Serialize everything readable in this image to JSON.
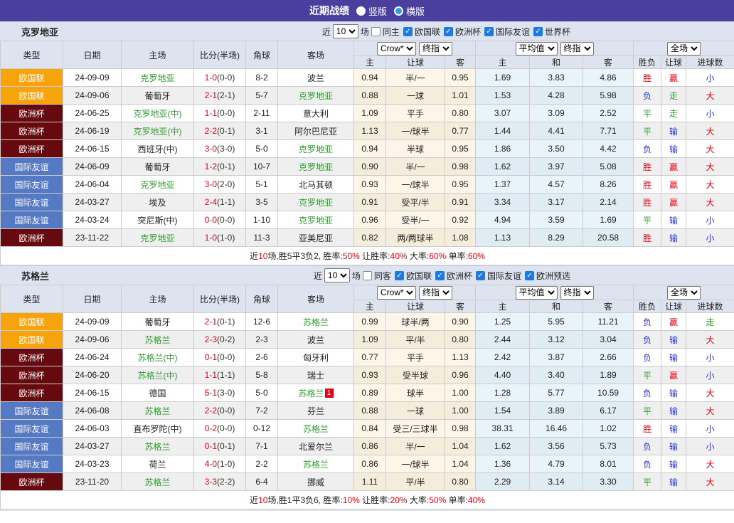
{
  "titlebar": {
    "title": "近期战绩",
    "radios": [
      {
        "label": "竖版",
        "selected": true
      },
      {
        "label": "横版",
        "selected": false
      }
    ]
  },
  "filter_labels": {
    "near": "近",
    "count": "10",
    "games": "场"
  },
  "table_head": {
    "cols": [
      "类型",
      "日期",
      "主场",
      "比分(半场)",
      "角球",
      "客场"
    ],
    "sub": [
      "主",
      "让球",
      "客",
      "主",
      "和",
      "客",
      "胜负",
      "让球",
      "进球数"
    ],
    "dropdowns": {
      "crow": "Crow*",
      "final1": "终指",
      "avg": "平均值",
      "final2": "终指",
      "full": "全场"
    }
  },
  "type_styles": {
    "欧国联": "#f7a30c",
    "欧洲杯": "#660a10",
    "国际友谊": "#5679c3"
  },
  "result_colors": {
    "red": "#e60012",
    "green": "#2f9e2f",
    "blue": "#2b35c9"
  },
  "sections": [
    {
      "team": "克罗地亚",
      "same_side_label": "同主",
      "leagues": [
        "欧国联",
        "欧洲杯",
        "国际友谊",
        "世界杯"
      ],
      "rows": [
        {
          "type": "欧国联",
          "date": "24-09-09",
          "home": "克罗地亚",
          "hg": true,
          "score": "1-0",
          "half": "(0-0)",
          "corner": "8-2",
          "away": "波兰",
          "ag": false,
          "odds": [
            "0.94",
            "半/一",
            "0.95"
          ],
          "avg": [
            "1.69",
            "3.83",
            "4.86"
          ],
          "res": [
            [
              "胜",
              "red"
            ],
            [
              "赢",
              "red"
            ],
            [
              "小",
              "blue"
            ]
          ]
        },
        {
          "type": "欧国联",
          "date": "24-09-06",
          "home": "葡萄牙",
          "hg": false,
          "score": "2-1",
          "half": "(2-1)",
          "corner": "5-7",
          "away": "克罗地亚",
          "ag": true,
          "odds": [
            "0.88",
            "一球",
            "1.01"
          ],
          "avg": [
            "1.53",
            "4.28",
            "5.98"
          ],
          "res": [
            [
              "负",
              "blue"
            ],
            [
              "走",
              "green"
            ],
            [
              "大",
              "red"
            ]
          ]
        },
        {
          "type": "欧洲杯",
          "date": "24-06-25",
          "home": "克罗地亚(中)",
          "hg": true,
          "score": "1-1",
          "half": "(0-0)",
          "corner": "2-11",
          "away": "意大利",
          "ag": false,
          "odds": [
            "1.09",
            "平手",
            "0.80"
          ],
          "avg": [
            "3.07",
            "3.09",
            "2.52"
          ],
          "res": [
            [
              "平",
              "green"
            ],
            [
              "走",
              "green"
            ],
            [
              "小",
              "blue"
            ]
          ]
        },
        {
          "type": "欧洲杯",
          "date": "24-06-19",
          "home": "克罗地亚(中)",
          "hg": true,
          "score": "2-2",
          "half": "(0-1)",
          "corner": "3-1",
          "away": "阿尔巴尼亚",
          "ag": false,
          "odds": [
            "1.13",
            "一/球半",
            "0.77"
          ],
          "avg": [
            "1.44",
            "4.41",
            "7.71"
          ],
          "res": [
            [
              "平",
              "green"
            ],
            [
              "输",
              "blue"
            ],
            [
              "大",
              "red"
            ]
          ]
        },
        {
          "type": "欧洲杯",
          "date": "24-06-15",
          "home": "西班牙(中)",
          "hg": false,
          "score": "3-0",
          "half": "(3-0)",
          "corner": "5-0",
          "away": "克罗地亚",
          "ag": true,
          "odds": [
            "0.94",
            "半球",
            "0.95"
          ],
          "avg": [
            "1.86",
            "3.50",
            "4.42"
          ],
          "res": [
            [
              "负",
              "blue"
            ],
            [
              "输",
              "blue"
            ],
            [
              "大",
              "red"
            ]
          ]
        },
        {
          "type": "国际友谊",
          "date": "24-06-09",
          "home": "葡萄牙",
          "hg": false,
          "score": "1-2",
          "half": "(0-1)",
          "corner": "10-7",
          "away": "克罗地亚",
          "ag": true,
          "odds": [
            "0.90",
            "半/一",
            "0.98"
          ],
          "avg": [
            "1.62",
            "3.97",
            "5.08"
          ],
          "res": [
            [
              "胜",
              "red"
            ],
            [
              "赢",
              "red"
            ],
            [
              "大",
              "red"
            ]
          ]
        },
        {
          "type": "国际友谊",
          "date": "24-06-04",
          "home": "克罗地亚",
          "hg": true,
          "score": "3-0",
          "half": "(2-0)",
          "corner": "5-1",
          "away": "北马其顿",
          "ag": false,
          "odds": [
            "0.93",
            "一/球半",
            "0.95"
          ],
          "avg": [
            "1.37",
            "4.57",
            "8.26"
          ],
          "res": [
            [
              "胜",
              "red"
            ],
            [
              "赢",
              "red"
            ],
            [
              "大",
              "red"
            ]
          ]
        },
        {
          "type": "国际友谊",
          "date": "24-03-27",
          "home": "埃及",
          "hg": false,
          "score": "2-4",
          "half": "(1-1)",
          "corner": "3-5",
          "away": "克罗地亚",
          "ag": true,
          "odds": [
            "0.91",
            "受平/半",
            "0.91"
          ],
          "avg": [
            "3.34",
            "3.17",
            "2.14"
          ],
          "res": [
            [
              "胜",
              "red"
            ],
            [
              "赢",
              "red"
            ],
            [
              "大",
              "red"
            ]
          ]
        },
        {
          "type": "国际友谊",
          "date": "24-03-24",
          "home": "突尼斯(中)",
          "hg": false,
          "score": "0-0",
          "half": "(0-0)",
          "corner": "1-10",
          "away": "克罗地亚",
          "ag": true,
          "odds": [
            "0.96",
            "受半/一",
            "0.92"
          ],
          "avg": [
            "4.94",
            "3.59",
            "1.69"
          ],
          "res": [
            [
              "平",
              "green"
            ],
            [
              "输",
              "blue"
            ],
            [
              "小",
              "blue"
            ]
          ]
        },
        {
          "type": "欧洲杯",
          "date": "23-11-22",
          "home": "克罗地亚",
          "hg": true,
          "score": "1-0",
          "half": "(1-0)",
          "corner": "11-3",
          "away": "亚美尼亚",
          "ag": false,
          "odds": [
            "0.82",
            "两/两球半",
            "1.08"
          ],
          "avg": [
            "1.13",
            "8.29",
            "20.58"
          ],
          "res": [
            [
              "胜",
              "red"
            ],
            [
              "输",
              "blue"
            ],
            [
              "小",
              "blue"
            ]
          ]
        }
      ],
      "summary": [
        {
          "t": "近",
          "red": false
        },
        {
          "t": "10",
          "red": true
        },
        {
          "t": "场,胜5平3负2, 胜率:",
          "red": false
        },
        {
          "t": "50%",
          "red": true
        },
        {
          "t": " 让胜率:",
          "red": false
        },
        {
          "t": "40%",
          "red": true
        },
        {
          "t": " 大率:",
          "red": false
        },
        {
          "t": "60%",
          "red": true
        },
        {
          "t": " 单率:",
          "red": false
        },
        {
          "t": "60%",
          "red": true
        }
      ]
    },
    {
      "team": "苏格兰",
      "same_side_label": "同客",
      "leagues": [
        "欧国联",
        "欧洲杯",
        "国际友谊",
        "欧洲预选"
      ],
      "rows": [
        {
          "type": "欧国联",
          "date": "24-09-09",
          "home": "葡萄牙",
          "hg": false,
          "score": "2-1",
          "half": "(0-1)",
          "corner": "12-6",
          "away": "苏格兰",
          "ag": true,
          "odds": [
            "0.99",
            "球半/两",
            "0.90"
          ],
          "avg": [
            "1.25",
            "5.95",
            "11.21"
          ],
          "res": [
            [
              "负",
              "blue"
            ],
            [
              "赢",
              "red"
            ],
            [
              "走",
              "green"
            ]
          ]
        },
        {
          "type": "欧国联",
          "date": "24-09-06",
          "home": "苏格兰",
          "hg": true,
          "score": "2-3",
          "half": "(0-2)",
          "corner": "2-3",
          "away": "波兰",
          "ag": false,
          "odds": [
            "1.09",
            "平/半",
            "0.80"
          ],
          "avg": [
            "2.44",
            "3.12",
            "3.04"
          ],
          "res": [
            [
              "负",
              "blue"
            ],
            [
              "输",
              "blue"
            ],
            [
              "大",
              "red"
            ]
          ]
        },
        {
          "type": "欧洲杯",
          "date": "24-06-24",
          "home": "苏格兰(中)",
          "hg": true,
          "score": "0-1",
          "half": "(0-0)",
          "corner": "2-6",
          "away": "匈牙利",
          "ag": false,
          "odds": [
            "0.77",
            "平手",
            "1.13"
          ],
          "avg": [
            "2.42",
            "3.87",
            "2.66"
          ],
          "res": [
            [
              "负",
              "blue"
            ],
            [
              "输",
              "blue"
            ],
            [
              "小",
              "blue"
            ]
          ]
        },
        {
          "type": "欧洲杯",
          "date": "24-06-20",
          "home": "苏格兰(中)",
          "hg": true,
          "score": "1-1",
          "half": "(1-1)",
          "corner": "5-8",
          "away": "瑞士",
          "ag": false,
          "odds": [
            "0.93",
            "受半球",
            "0.96"
          ],
          "avg": [
            "4.40",
            "3.40",
            "1.89"
          ],
          "res": [
            [
              "平",
              "green"
            ],
            [
              "赢",
              "red"
            ],
            [
              "小",
              "blue"
            ]
          ]
        },
        {
          "type": "欧洲杯",
          "date": "24-06-15",
          "home": "德国",
          "hg": false,
          "score": "5-1",
          "half": "(3-0)",
          "corner": "5-0",
          "away": "苏格兰",
          "ag": true,
          "ab": "1",
          "odds": [
            "0.89",
            "球半",
            "1.00"
          ],
          "avg": [
            "1.28",
            "5.77",
            "10.59"
          ],
          "res": [
            [
              "负",
              "blue"
            ],
            [
              "输",
              "blue"
            ],
            [
              "大",
              "red"
            ]
          ]
        },
        {
          "type": "国际友谊",
          "date": "24-06-08",
          "home": "苏格兰",
          "hg": true,
          "score": "2-2",
          "half": "(0-0)",
          "corner": "7-2",
          "away": "芬兰",
          "ag": false,
          "odds": [
            "0.88",
            "一球",
            "1.00"
          ],
          "avg": [
            "1.54",
            "3.89",
            "6.17"
          ],
          "res": [
            [
              "平",
              "green"
            ],
            [
              "输",
              "blue"
            ],
            [
              "大",
              "red"
            ]
          ]
        },
        {
          "type": "国际友谊",
          "date": "24-06-03",
          "home": "直布罗陀(中)",
          "hg": false,
          "score": "0-2",
          "half": "(0-0)",
          "corner": "0-12",
          "away": "苏格兰",
          "ag": true,
          "odds": [
            "0.84",
            "受三/三球半",
            "0.98"
          ],
          "avg": [
            "38.31",
            "16.46",
            "1.02"
          ],
          "res": [
            [
              "胜",
              "red"
            ],
            [
              "输",
              "blue"
            ],
            [
              "小",
              "blue"
            ]
          ]
        },
        {
          "type": "国际友谊",
          "date": "24-03-27",
          "home": "苏格兰",
          "hg": true,
          "score": "0-1",
          "half": "(0-1)",
          "corner": "7-1",
          "away": "北爱尔兰",
          "ag": false,
          "odds": [
            "0.86",
            "半/一",
            "1.04"
          ],
          "avg": [
            "1.62",
            "3.56",
            "5.73"
          ],
          "res": [
            [
              "负",
              "blue"
            ],
            [
              "输",
              "blue"
            ],
            [
              "小",
              "blue"
            ]
          ]
        },
        {
          "type": "国际友谊",
          "date": "24-03-23",
          "home": "荷兰",
          "hg": false,
          "score": "4-0",
          "half": "(1-0)",
          "corner": "2-2",
          "away": "苏格兰",
          "ag": true,
          "odds": [
            "0.86",
            "一/球半",
            "1.04"
          ],
          "avg": [
            "1.36",
            "4.79",
            "8.01"
          ],
          "res": [
            [
              "负",
              "blue"
            ],
            [
              "输",
              "blue"
            ],
            [
              "大",
              "red"
            ]
          ]
        },
        {
          "type": "欧洲杯",
          "date": "23-11-20",
          "home": "苏格兰",
          "hg": true,
          "score": "3-3",
          "half": "(2-2)",
          "corner": "6-4",
          "away": "挪威",
          "ag": false,
          "odds": [
            "1.11",
            "平/半",
            "0.80"
          ],
          "avg": [
            "2.29",
            "3.14",
            "3.30"
          ],
          "res": [
            [
              "平",
              "green"
            ],
            [
              "输",
              "blue"
            ],
            [
              "大",
              "red"
            ]
          ]
        }
      ],
      "summary": [
        {
          "t": "近",
          "red": false
        },
        {
          "t": "10",
          "red": true
        },
        {
          "t": "场,胜1平3负6, 胜率:",
          "red": false
        },
        {
          "t": "10%",
          "red": true
        },
        {
          "t": " 让胜率:",
          "red": false
        },
        {
          "t": "20%",
          "red": true
        },
        {
          "t": " 大率:",
          "red": false
        },
        {
          "t": "50%",
          "red": true
        },
        {
          "t": " 单率:",
          "red": false
        },
        {
          "t": "40%",
          "red": true
        }
      ]
    }
  ]
}
